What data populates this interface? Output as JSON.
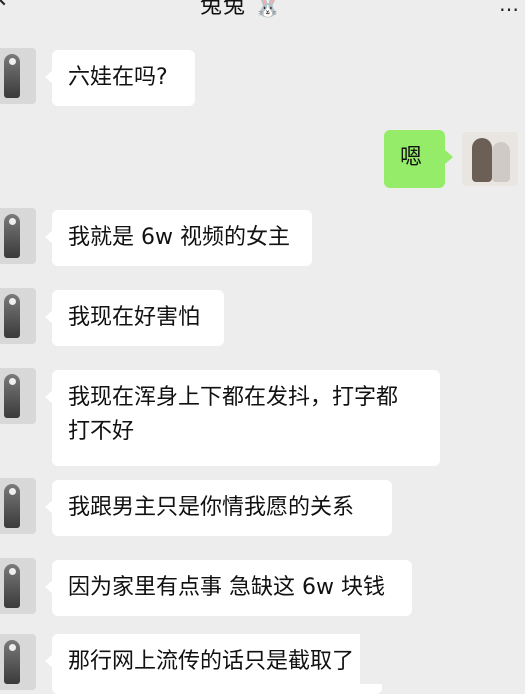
{
  "header": {
    "title": "兔兔 🐰"
  },
  "colors": {
    "background": "#ededed",
    "incoming_bubble": "#ffffff",
    "outgoing_bubble": "#95ec69"
  },
  "messages": [
    {
      "side": "left",
      "text": "六娃在吗?"
    },
    {
      "side": "right",
      "text": "嗯"
    },
    {
      "side": "left",
      "text": "我就是 6w 视频的女主"
    },
    {
      "side": "left",
      "text": "我现在好害怕"
    },
    {
      "side": "left",
      "text": "我现在浑身上下都在发抖，打字都\n打不好"
    },
    {
      "side": "left",
      "text": "我跟男主只是你情我愿的关系"
    },
    {
      "side": "left",
      "text": "因为家里有点事 急缺这 6w 块钱"
    },
    {
      "side": "left",
      "text": "那行网上流传的话只是截取了"
    }
  ]
}
